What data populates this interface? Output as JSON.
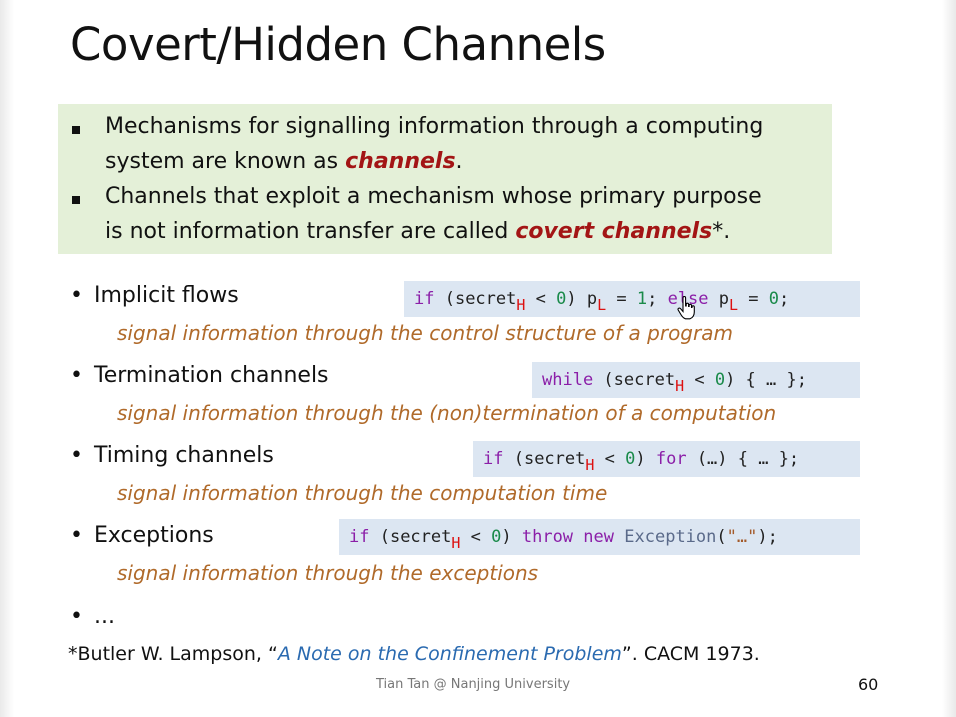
{
  "slide": {
    "title": "Covert/Hidden Channels",
    "green_box": {
      "p1_line1": "Mechanisms for signalling information through a computing",
      "p1_line2_pre": "system are known as ",
      "p1_line2_em": "channels",
      "p1_line2_post": ".",
      "p2_line1": "Channels that exploit a mechanism whose primary purpose",
      "p2_line2_pre": "is not information transfer are called ",
      "p2_line2_em": "covert channels",
      "p2_line2_post": "*."
    },
    "items": [
      {
        "bullet": "•",
        "title": "Implicit flows",
        "desc": "signal information through the control structure of a program",
        "code": {
          "if": "if",
          "open": " (secret",
          "h": "H",
          "lt": " < ",
          "zero": "0",
          "close": ") p",
          "l1": "L",
          "eq": " = ",
          "one": "1",
          "semi": "; ",
          "else": "else",
          "p2": " p",
          "l2": "L",
          "eq2": " = ",
          "zero2": "0",
          "end": ";"
        }
      },
      {
        "bullet": "•",
        "title": "Termination channels",
        "desc": "signal information through the (non)termination of a computation",
        "code": {
          "while": "while",
          "open": " (secret",
          "h": "H",
          "lt": " < ",
          "zero": "0",
          "end": ") { … };"
        }
      },
      {
        "bullet": "•",
        "title": "Timing channels",
        "desc": "signal information through the computation time",
        "code": {
          "if": "if",
          "open": " (secret",
          "h": "H",
          "lt": " < ",
          "zero": "0",
          "close": ") ",
          "for": "for",
          "end": " (…) { … };"
        }
      },
      {
        "bullet": "•",
        "title": "Exceptions",
        "desc": "signal information through the exceptions",
        "code": {
          "if": "if",
          "open": " (secret",
          "h": "H",
          "lt": " < ",
          "zero": "0",
          "close": ") ",
          "throw": "throw",
          "sp": " ",
          "new": "new",
          "sp2": " ",
          "exc": "Exception",
          "paren": "(",
          "str": "\"…\"",
          "end": ");"
        }
      }
    ],
    "ellipsis_bullet": "•",
    "ellipsis": "...",
    "footnote": {
      "marker": "*",
      "author": "Butler W. Lampson, “",
      "link": "A Note on the Confinement Problem",
      "rest": "”. CACM 1973."
    },
    "footer": "Tian Tan @ Nanjing University",
    "page_number": "60"
  },
  "colors": {
    "green_box_bg": "#e4f0d8",
    "code_bg": "#dce6f2",
    "emphasis_red": "#a31515",
    "description_orange": "#b06a2a",
    "keyword_purple": "#8b1fa8",
    "number_green": "#1a8a4a",
    "link_blue": "#2a6ab0"
  },
  "icons": [
    "hand-cursor-icon",
    "square-bullet-icon"
  ]
}
